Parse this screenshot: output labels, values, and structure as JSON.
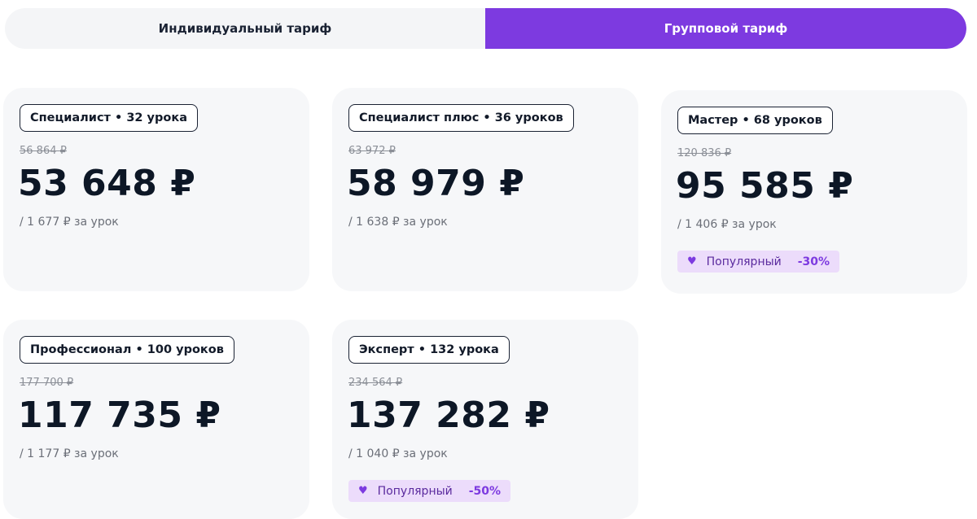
{
  "tabs": {
    "individual": "Индивидуальный тариф",
    "group": "Групповой тариф",
    "active": "group"
  },
  "colors": {
    "accent": "#7d3ae0",
    "badge_bg": "#ecdcfb",
    "card_bg": "#f6f7f9"
  },
  "plans": [
    {
      "name": "Специалист • 32 урока",
      "old_price": "56 864 ₽",
      "price": "53 648 ₽",
      "per_lesson": "/ 1 677 ₽ за урок"
    },
    {
      "name": "Специалист плюс • 36 уроков",
      "old_price": "63 972 ₽",
      "price": "58 979 ₽",
      "per_lesson": "/ 1 638 ₽ за урок"
    },
    {
      "name": "Мастер • 68 уроков",
      "old_price": "120 836 ₽",
      "price": "95 585 ₽",
      "per_lesson": "/ 1 406 ₽ за урок",
      "popular_label": "Популярный",
      "discount": "-30%",
      "popular_icon": "heart-icon"
    },
    {
      "name": "Профессионал • 100 уроков",
      "old_price": "177 700 ₽",
      "price": "117 735 ₽",
      "per_lesson": "/ 1 177 ₽ за урок"
    },
    {
      "name": "Эксперт • 132 урока",
      "old_price": "234 564 ₽",
      "price": "137 282 ₽",
      "per_lesson": "/ 1 040 ₽ за урок",
      "popular_label": "Популярный",
      "discount": "-50%",
      "popular_icon": "heart-icon"
    }
  ]
}
